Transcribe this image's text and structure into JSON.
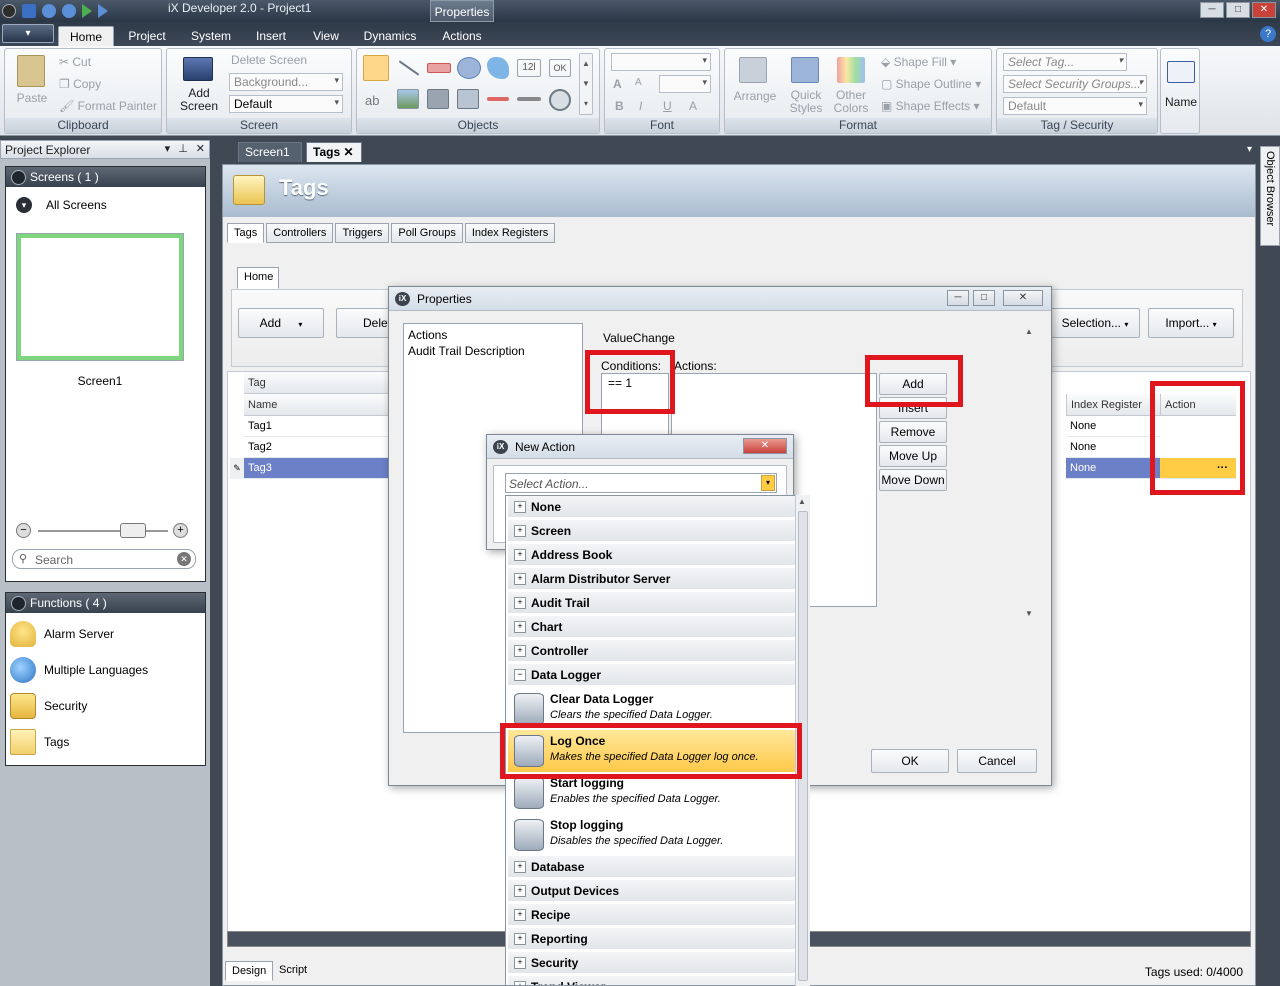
{
  "window": {
    "title": "iX Developer 2.0 - Project1",
    "context_tab": "Properties"
  },
  "ribbon_tabs": [
    "Home",
    "Project",
    "System",
    "Insert",
    "View",
    "Dynamics",
    "Actions"
  ],
  "ribbon": {
    "clipboard": {
      "paste": "Paste",
      "cut": "Cut",
      "copy": "Copy",
      "format_painter": "Format Painter",
      "label": "Clipboard"
    },
    "screen": {
      "add_screen": "Add Screen",
      "delete_screen": "Delete Screen",
      "background": "Background...",
      "default": "Default",
      "label": "Screen"
    },
    "objects": {
      "label": "Objects",
      "num_icon": "12l",
      "ok_icon": "OK",
      "ab": "ab"
    },
    "font": {
      "label": "Font",
      "bold": "B",
      "italic": "I",
      "underline": "U",
      "a1": "A",
      "a2": "A",
      "a3": "A"
    },
    "format": {
      "arrange": "Arrange",
      "quick_styles": "Quick Styles",
      "other_colors": "Other Colors",
      "shape_fill": "Shape Fill",
      "shape_outline": "Shape Outline",
      "shape_effects": "Shape Effects",
      "label": "Format"
    },
    "tag_security": {
      "select_tag": "Select Tag...",
      "select_security": "Select Security Groups...",
      "default": "Default",
      "name": "Name",
      "label": "Tag / Security"
    }
  },
  "project_explorer": {
    "title": "Project Explorer",
    "screens_header": "Screens ( 1 )",
    "all_screens": "All Screens",
    "screen_name": "Screen1",
    "search_placeholder": "Search",
    "functions_header": "Functions ( 4 )",
    "functions": [
      "Alarm Server",
      "Multiple Languages",
      "Security",
      "Tags"
    ]
  },
  "side_panel": {
    "object_browser": "Object Browser"
  },
  "doc_tabs": [
    "Screen1",
    "Tags"
  ],
  "tags_doc": {
    "header": "Tags",
    "subtabs": [
      "Tags",
      "Controllers",
      "Triggers",
      "Poll Groups",
      "Index Registers"
    ],
    "toolbar_tab": "Home",
    "add": "Add",
    "delete": "Delete",
    "selection": "Selection...",
    "import": "Import...",
    "grid_group": "Tag",
    "columns": {
      "name": "Name",
      "index_register": "Index Register",
      "action": "Action"
    },
    "rows": [
      {
        "name": "Tag1",
        "index": "None",
        "action": ""
      },
      {
        "name": "Tag2",
        "index": "None",
        "action": ""
      },
      {
        "name": "Tag3",
        "index": "None",
        "action": "···"
      }
    ],
    "bottom_tabs": [
      "Design",
      "Script"
    ],
    "tags_used": "Tags used: 0/4000"
  },
  "properties_dialog": {
    "title": "Properties",
    "left_items": [
      "Actions",
      "Audit Trail Description"
    ],
    "group": "ValueChange",
    "conditions_label": "Conditions:",
    "condition_value": "== 1",
    "actions_label": "Actions:",
    "buttons": [
      "Add",
      "Insert",
      "Remove",
      "Move Up",
      "Move Down"
    ],
    "ok": "OK",
    "cancel": "Cancel"
  },
  "new_action_dialog": {
    "title": "New Action",
    "placeholder": "Select Action...",
    "categories_top": [
      "None",
      "Screen",
      "Address Book",
      "Alarm Distributor Server",
      "Audit Trail",
      "Chart",
      "Controller",
      "Data Logger"
    ],
    "actions": [
      {
        "name": "Clear Data Logger",
        "desc": "Clears the specified Data Logger."
      },
      {
        "name": "Log Once",
        "desc": "Makes the specified Data Logger log once."
      },
      {
        "name": "Start logging",
        "desc": "Enables the specified Data Logger."
      },
      {
        "name": "Stop logging",
        "desc": "Disables the specified Data Logger."
      }
    ],
    "categories_bottom": [
      "Database",
      "Output Devices",
      "Recipe",
      "Reporting",
      "Security",
      "Trend Viewer"
    ]
  },
  "colors": {
    "highlight": "#ffc94a",
    "annotation": "#e0161f",
    "selection": "#6b80c7"
  }
}
